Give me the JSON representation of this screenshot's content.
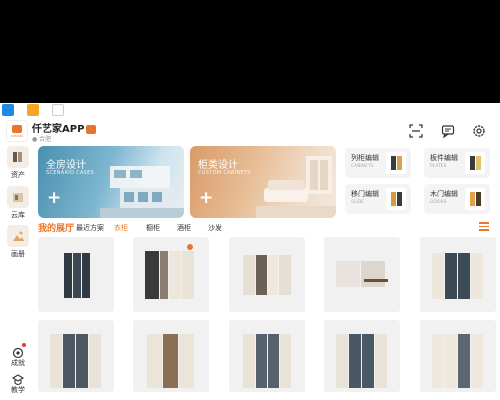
{
  "app": {
    "title": "仟艺家APP",
    "location": "合肥",
    "logo_text": "ICHANG"
  },
  "header_icons": [
    "scan-icon",
    "message-icon",
    "settings-icon"
  ],
  "sidebar": {
    "items": [
      {
        "label": "资产",
        "icon": "asset-icon"
      },
      {
        "label": "云库",
        "icon": "cloud-library-icon"
      },
      {
        "label": "画册",
        "icon": "album-icon"
      }
    ],
    "bottom": [
      {
        "label": "成就",
        "icon": "achievement-icon"
      },
      {
        "label": "教学",
        "icon": "teaching-icon"
      }
    ]
  },
  "hero_cards": [
    {
      "title": "全房设计",
      "subtitle": "SCENARIO CASES",
      "action": "+"
    },
    {
      "title": "柜类设计",
      "subtitle": "CUSTOM CABINETS",
      "action": "+"
    }
  ],
  "mini_cards": [
    {
      "title": "列柜编辑",
      "subtitle": "CABINETS"
    },
    {
      "title": "板件编辑",
      "subtitle": "PLATES"
    },
    {
      "title": "移门编辑",
      "subtitle": "SLIDE"
    },
    {
      "title": "木门编辑",
      "subtitle": "DOORS"
    }
  ],
  "tabs": {
    "main": "我的展厅",
    "items": [
      "最近方案",
      "衣柜",
      "橱柜",
      "酒柜",
      "沙发"
    ],
    "active": "衣柜"
  },
  "colors": {
    "accent": "#e8762a",
    "card_bg": "#f1f1f1"
  }
}
